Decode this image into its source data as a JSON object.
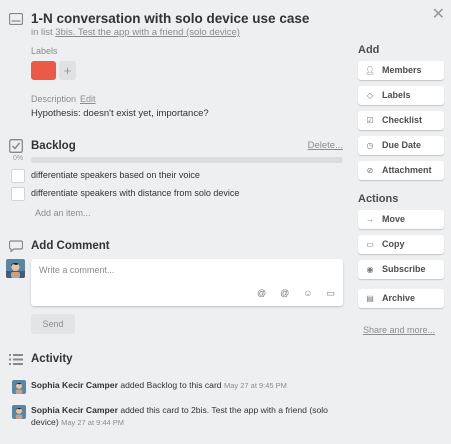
{
  "card": {
    "title": "1-N conversation with solo device use case",
    "in_list_prefix": "in list",
    "list_name": "3bis. Test the app with a friend (solo device)"
  },
  "labels": {
    "heading": "Labels",
    "colors": [
      "#eb5a46"
    ],
    "add_glyph": "+"
  },
  "description": {
    "heading": "Description",
    "edit_label": "Edit",
    "text": "Hypothesis: doesn't exist yet, importance?"
  },
  "checklist": {
    "title": "Backlog",
    "delete_label": "Delete...",
    "percent": "0%",
    "progress_fraction": 0,
    "items": [
      {
        "text": "differentiate speakers based on their voice",
        "checked": false
      },
      {
        "text": "differentiate speakers with distance from solo device",
        "checked": false
      }
    ],
    "add_item": "Add an item..."
  },
  "comment": {
    "heading": "Add Comment",
    "placeholder": "Write a comment...",
    "icons": [
      "attachment-icon",
      "mention-icon",
      "emoji-icon",
      "card-icon"
    ],
    "send_label": "Send"
  },
  "activity": {
    "heading": "Activity",
    "entries": [
      {
        "user": "Sophia Kecir Camper",
        "action": "added Backlog to this card",
        "time": "May 27 at 9:45 PM"
      },
      {
        "user": "Sophia Kecir Camper",
        "action": "added this card to 2bis. Test the app with a friend (solo device)",
        "time": "May 27 at 9:44 PM"
      }
    ]
  },
  "sidebar": {
    "add_heading": "Add",
    "add_buttons": [
      {
        "label": "Members",
        "icon": "person-icon"
      },
      {
        "label": "Labels",
        "icon": "tag-icon"
      },
      {
        "label": "Checklist",
        "icon": "checklist-icon"
      },
      {
        "label": "Due Date",
        "icon": "clock-icon"
      },
      {
        "label": "Attachment",
        "icon": "paperclip-icon"
      }
    ],
    "actions_heading": "Actions",
    "action_buttons": [
      {
        "label": "Move",
        "icon": "arrow-right-icon"
      },
      {
        "label": "Copy",
        "icon": "card-icon"
      },
      {
        "label": "Subscribe",
        "icon": "eye-icon"
      },
      {
        "label": "Archive",
        "icon": "archive-icon"
      }
    ],
    "share_label": "Share and more..."
  }
}
